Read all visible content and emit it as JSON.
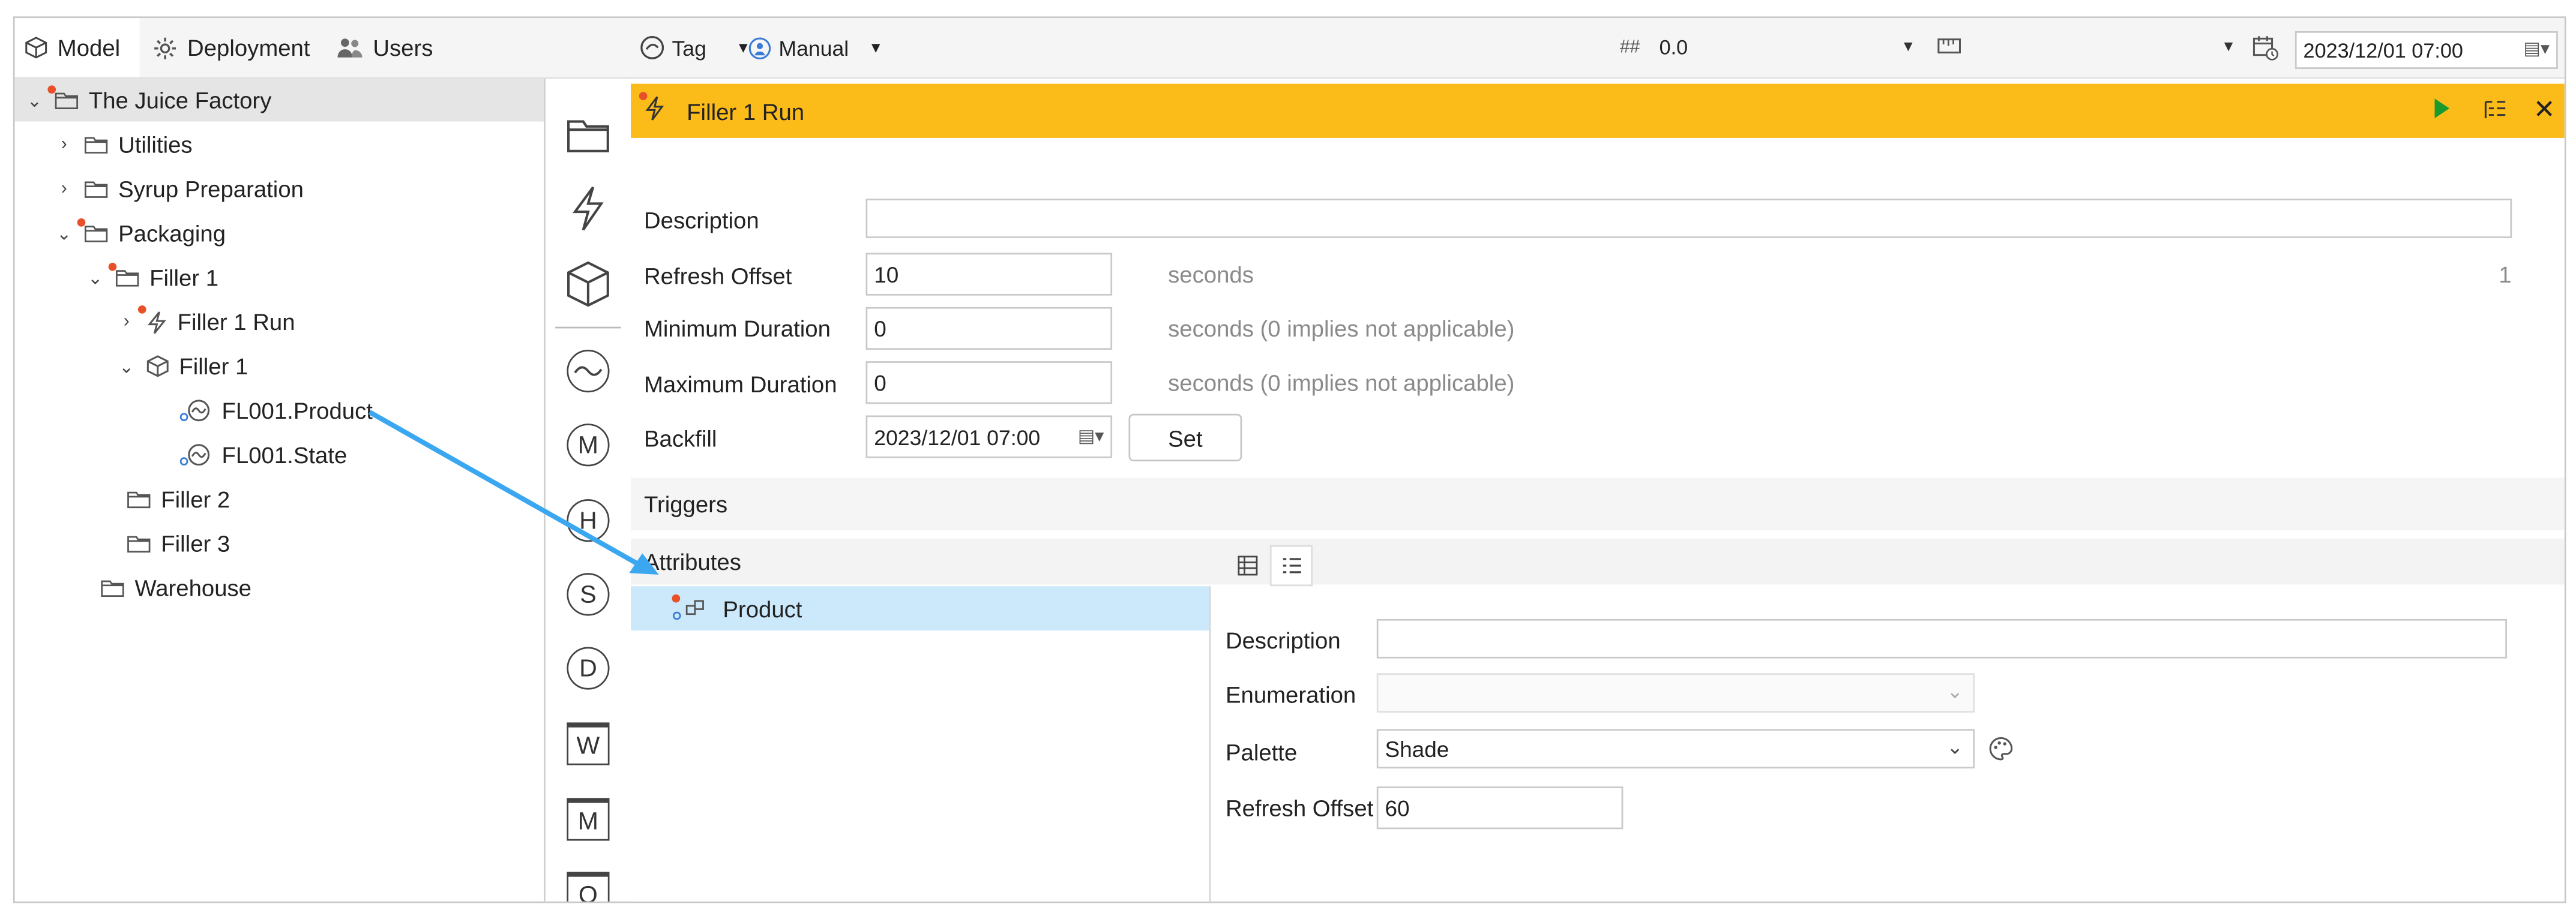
{
  "colors": {
    "accent": "#fbbc1a",
    "selection": "#cce8fb",
    "arrow": "#3aa7f0",
    "marker": "#e8502a"
  },
  "tabs": [
    {
      "label": "Model",
      "icon": "cube-icon"
    },
    {
      "label": "Deployment",
      "icon": "gear-icon"
    },
    {
      "label": "Users",
      "icon": "users-icon"
    }
  ],
  "toolbar": {
    "tag_label": "Tag",
    "mode_label": "Manual",
    "hash_value": "0.0",
    "range_value": "",
    "datetime_value": "2023/12/01 07:00"
  },
  "tree": [
    {
      "label": "The Juice Factory"
    },
    {
      "label": "Utilities"
    },
    {
      "label": "Syrup Preparation"
    },
    {
      "label": "Packaging"
    },
    {
      "label": "Filler 1"
    },
    {
      "label": "Filler 1 Run"
    },
    {
      "label": "Filler 1"
    },
    {
      "label": "FL001.Product"
    },
    {
      "label": "FL001.State"
    },
    {
      "label": "Filler 2"
    },
    {
      "label": "Filler 3"
    },
    {
      "label": "Warehouse"
    }
  ],
  "strip": {
    "letters": [
      "M",
      "H",
      "S",
      "D",
      "W",
      "M",
      "Q"
    ]
  },
  "editor": {
    "title": "Filler 1 Run",
    "description_label": "Description",
    "description_value": "",
    "refresh_offset_label": "Refresh Offset",
    "refresh_offset_value": "10",
    "refresh_offset_hint": "seconds",
    "right_counter": "1",
    "min_duration_label": "Minimum Duration",
    "min_duration_value": "0",
    "min_duration_hint": "seconds (0 implies not applicable)",
    "max_duration_label": "Maximum Duration",
    "max_duration_value": "0",
    "max_duration_hint": "seconds (0 implies not applicable)",
    "backfill_label": "Backfill",
    "backfill_value": "2023/12/01 07:00",
    "set_label": "Set",
    "triggers_label": "Triggers",
    "attributes_label": "Attributes",
    "attribute_item": "Product"
  },
  "attr_detail": {
    "description_label": "Description",
    "description_value": "",
    "enumeration_label": "Enumeration",
    "enumeration_value": "",
    "palette_label": "Palette",
    "palette_value": "Shade",
    "refresh_offset_label": "Refresh Offset",
    "refresh_offset_value": "60"
  }
}
